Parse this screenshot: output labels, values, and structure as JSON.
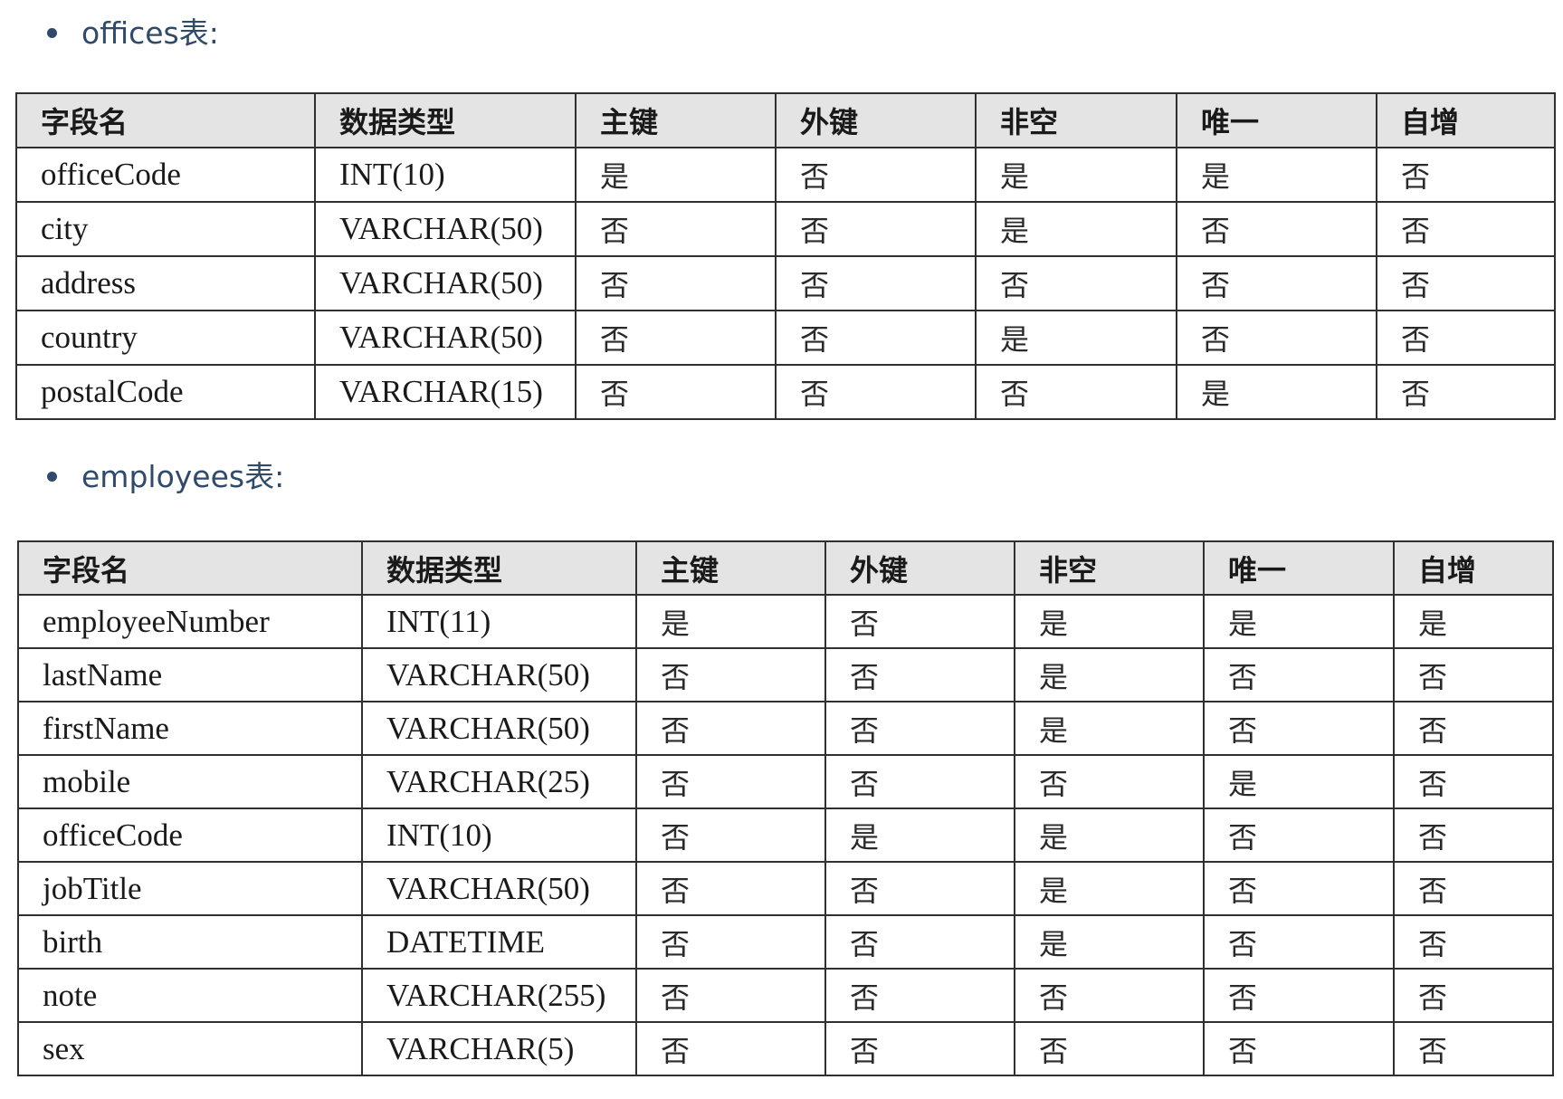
{
  "sections": [
    {
      "title": "offices表:",
      "headers": [
        "字段名",
        "数据类型",
        "主键",
        "外键",
        "非空",
        "唯一",
        "自增"
      ],
      "rows": [
        [
          "officeCode",
          "INT(10)",
          "是",
          "否",
          "是",
          "是",
          "否"
        ],
        [
          "city",
          "VARCHAR(50)",
          "否",
          "否",
          "是",
          "否",
          "否"
        ],
        [
          "address",
          "VARCHAR(50)",
          "否",
          "否",
          "否",
          "否",
          "否"
        ],
        [
          "country",
          "VARCHAR(50)",
          "否",
          "否",
          "是",
          "否",
          "否"
        ],
        [
          "postalCode",
          "VARCHAR(15)",
          "否",
          "否",
          "否",
          "是",
          "否"
        ]
      ]
    },
    {
      "title": "employees表:",
      "headers": [
        "字段名",
        "数据类型",
        "主键",
        "外键",
        "非空",
        "唯一",
        "自增"
      ],
      "rows": [
        [
          "employeeNumber",
          "INT(11)",
          "是",
          "否",
          "是",
          "是",
          "是"
        ],
        [
          "lastName",
          "VARCHAR(50)",
          "否",
          "否",
          "是",
          "否",
          "否"
        ],
        [
          "firstName",
          "VARCHAR(50)",
          "否",
          "否",
          "是",
          "否",
          "否"
        ],
        [
          "mobile",
          "VARCHAR(25)",
          "否",
          "否",
          "否",
          "是",
          "否"
        ],
        [
          "officeCode",
          "INT(10)",
          "否",
          "是",
          "是",
          "否",
          "否"
        ],
        [
          "jobTitle",
          "VARCHAR(50)",
          "否",
          "否",
          "是",
          "否",
          "否"
        ],
        [
          "birth",
          "DATETIME",
          "否",
          "否",
          "是",
          "否",
          "否"
        ],
        [
          "note",
          "VARCHAR(255)",
          "否",
          "否",
          "否",
          "否",
          "否"
        ],
        [
          "sex",
          "VARCHAR(5)",
          "否",
          "否",
          "否",
          "否",
          "否"
        ]
      ]
    }
  ]
}
